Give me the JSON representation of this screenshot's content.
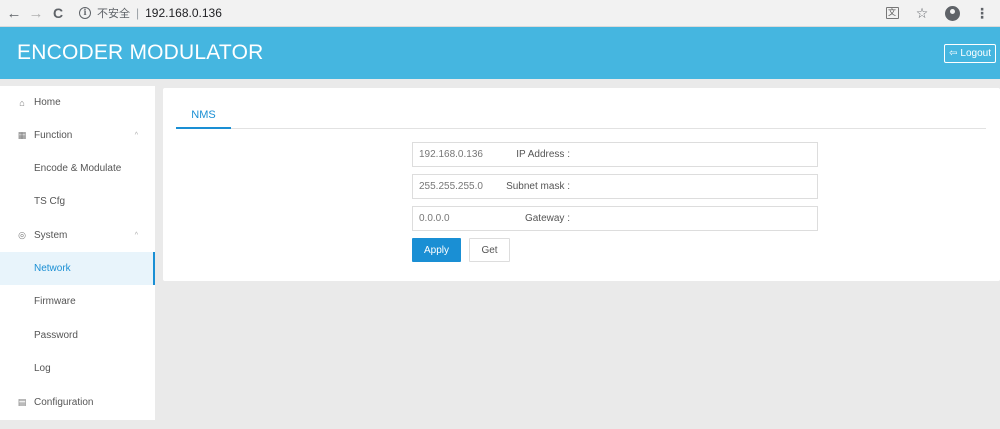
{
  "browser": {
    "back_icon": "←",
    "forward_icon": "→",
    "reload_icon": "C",
    "info_icon": "i",
    "insecure_label": "不安全",
    "separator": "|",
    "url": "192.168.0.136",
    "translate_icon": "文",
    "star_icon": "☆",
    "menu_icon": "⋮"
  },
  "header": {
    "title": "ENCODER MODULATOR",
    "logout_label": "Logout",
    "logout_icon": "⇦"
  },
  "sidebar": {
    "items": [
      {
        "label": "Home",
        "icon": "⌂",
        "chevron": ""
      },
      {
        "label": "Function",
        "icon": "▦",
        "chevron": "^"
      },
      {
        "label": "Encode & Modulate",
        "icon": "",
        "chevron": ""
      },
      {
        "label": "TS Cfg",
        "icon": "",
        "chevron": ""
      },
      {
        "label": "System",
        "icon": "◎",
        "chevron": "^"
      },
      {
        "label": "Network",
        "icon": "",
        "chevron": ""
      },
      {
        "label": "Firmware",
        "icon": "",
        "chevron": ""
      },
      {
        "label": "Password",
        "icon": "",
        "chevron": ""
      },
      {
        "label": "Log",
        "icon": "",
        "chevron": ""
      },
      {
        "label": "Configuration",
        "icon": "▤",
        "chevron": ""
      }
    ],
    "active": "Network"
  },
  "main": {
    "tab": "NMS",
    "fields": [
      {
        "label": "IP Address :",
        "value": "192.168.0.136"
      },
      {
        "label": "Subnet mask :",
        "value": "255.255.255.0"
      },
      {
        "label": "Gateway :",
        "value": "0.0.0.0"
      }
    ],
    "apply_label": "Apply",
    "get_label": "Get"
  },
  "colors": {
    "header_bg": "#45b6e0",
    "accent": "#1a8fd4"
  }
}
